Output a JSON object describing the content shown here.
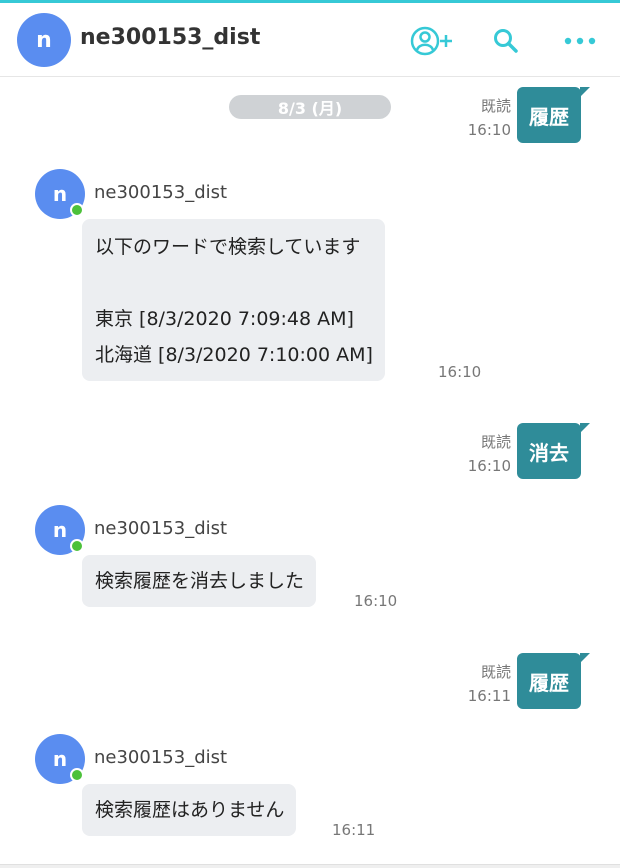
{
  "header": {
    "avatar_initial": "n",
    "title": "ne300153_dist"
  },
  "chat": {
    "date_label": "8/3 (月)",
    "messages": [
      {
        "type": "sent",
        "text": "履歴",
        "status": "既読",
        "time": "16:10"
      },
      {
        "type": "received",
        "avatar_initial": "n",
        "sender": "ne300153_dist",
        "lines": [
          "以下のワードで検索しています",
          "",
          "東京 [8/3/2020 7:09:48 AM]",
          "北海道 [8/3/2020 7:10:00 AM]"
        ],
        "time": "16:10"
      },
      {
        "type": "sent",
        "text": "消去",
        "status": "既読",
        "time": "16:10"
      },
      {
        "type": "received",
        "avatar_initial": "n",
        "sender": "ne300153_dist",
        "lines": [
          "検索履歴を消去しました"
        ],
        "time": "16:10"
      },
      {
        "type": "sent",
        "text": "履歴",
        "status": "既読",
        "time": "16:11"
      },
      {
        "type": "received",
        "avatar_initial": "n",
        "sender": "ne300153_dist",
        "lines": [
          "検索履歴はありません"
        ],
        "time": "16:11"
      }
    ]
  },
  "icons": {
    "add_user": "add-user-icon",
    "search": "search-icon",
    "more": "more-icon"
  },
  "colors": {
    "accent": "#36c9d6",
    "sent_bubble": "#2f8c99",
    "avatar": "#5a8df0",
    "online": "#4cc13a",
    "received_bubble": "#eceef1"
  }
}
